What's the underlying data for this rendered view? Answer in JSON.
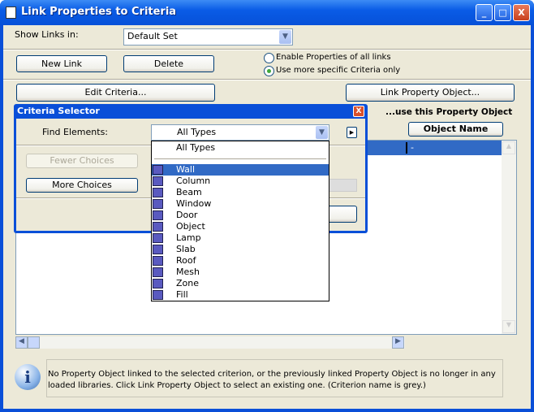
{
  "window": {
    "title": "Link Properties to Criteria",
    "minimize": "_",
    "maximize": "□",
    "close": "X"
  },
  "show_links": {
    "label": "Show Links in:",
    "value": "Default Set"
  },
  "buttons": {
    "new_link": "New Link",
    "delete": "Delete",
    "edit_criteria": "Edit Criteria...",
    "link_property_object": "Link Property Object..."
  },
  "radios": [
    {
      "label": "Enable Properties of all links",
      "checked": false
    },
    {
      "label": "Use more specific Criteria only",
      "checked": true
    }
  ],
  "right_header": "...use this Property Object",
  "object_name_header": "Object Name",
  "list": {
    "rows": [
      {
        "criterion": "",
        "object": "-",
        "selected": true
      }
    ]
  },
  "info_text": "No Property Object linked to the selected criterion, or the previously linked Property Object is no longer in any loaded libraries. Click Link Property Object to select an existing one. (Criterion name is grey.)",
  "criteria_selector": {
    "title": "Criteria Selector",
    "find_label": "Find Elements:",
    "find_value": "All Types",
    "fewer_choices": "Fewer Choices",
    "more_choices": "More Choices",
    "dropdown": {
      "top_item": "All Types",
      "items": [
        {
          "label": "Wall",
          "icon": "wall-icon",
          "selected": true
        },
        {
          "label": "Column",
          "icon": "column-icon"
        },
        {
          "label": "Beam",
          "icon": "beam-icon"
        },
        {
          "label": "Window",
          "icon": "window-icon"
        },
        {
          "label": "Door",
          "icon": "door-icon"
        },
        {
          "label": "Object",
          "icon": "object-icon"
        },
        {
          "label": "Lamp",
          "icon": "lamp-icon"
        },
        {
          "label": "Slab",
          "icon": "slab-icon"
        },
        {
          "label": "Roof",
          "icon": "roof-icon"
        },
        {
          "label": "Mesh",
          "icon": "mesh-icon"
        },
        {
          "label": "Zone",
          "icon": "zone-icon"
        },
        {
          "label": "Fill",
          "icon": "fill-icon"
        }
      ]
    }
  },
  "colors": {
    "title_blue": "#0a5ce6",
    "selection": "#316ac5",
    "face": "#ece9d8"
  }
}
